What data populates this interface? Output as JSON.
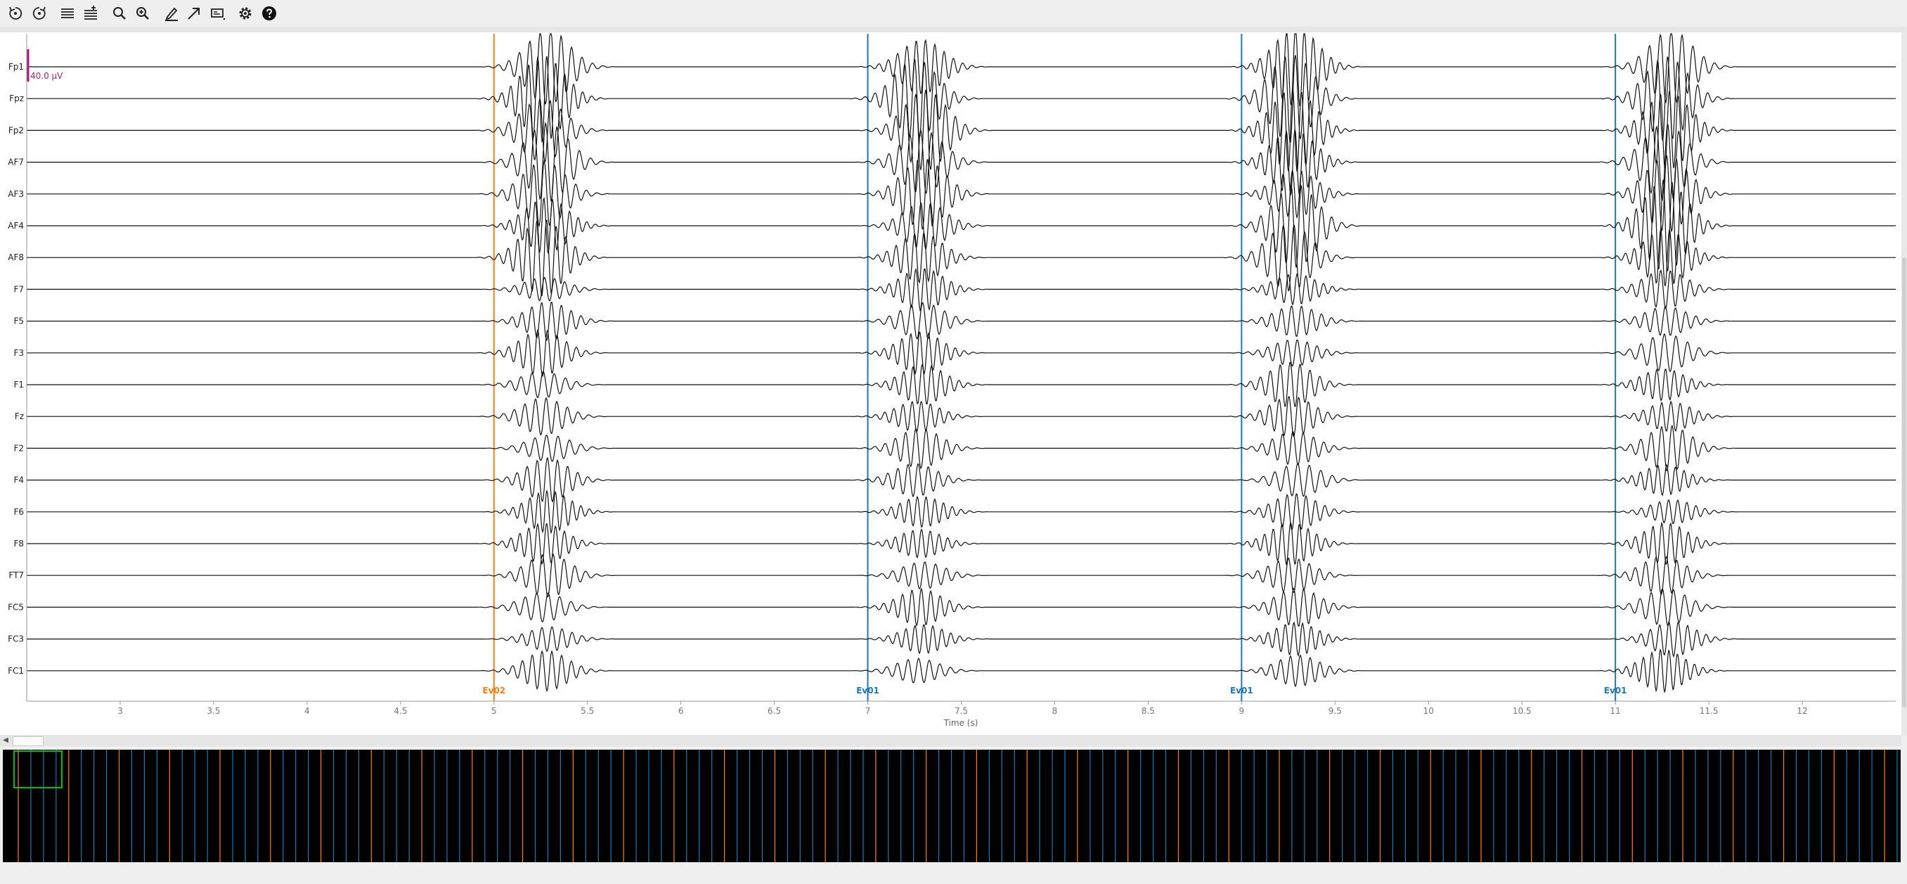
{
  "toolbar": {
    "buttons": [
      {
        "name": "undo-rotate-button",
        "icon": "rotate-left-icon"
      },
      {
        "name": "redo-rotate-button",
        "icon": "rotate-right-icon"
      },
      {
        "name": "fewer-channels-button",
        "icon": "lines-icon"
      },
      {
        "name": "more-channels-button",
        "icon": "lines-plus-icon"
      },
      {
        "name": "zoom-out-button",
        "icon": "zoom-out-icon"
      },
      {
        "name": "zoom-in-button",
        "icon": "zoom-in-icon"
      },
      {
        "name": "annotate-button",
        "icon": "pencil-icon"
      },
      {
        "name": "projectors-button",
        "icon": "arrow-icon"
      },
      {
        "name": "display-button",
        "icon": "display-icon"
      },
      {
        "name": "settings-button",
        "icon": "gear-icon"
      },
      {
        "name": "help-button",
        "icon": "help-icon"
      }
    ]
  },
  "channels": [
    "Fp1",
    "Fpz",
    "Fp2",
    "AF7",
    "AF3",
    "AF4",
    "AF8",
    "F7",
    "F5",
    "F3",
    "F1",
    "Fz",
    "F2",
    "F4",
    "F6",
    "F8",
    "FT7",
    "FC5",
    "FC3",
    "FC1"
  ],
  "scale_bar_label": "40.0 µV",
  "x_axis": {
    "label": "Time (s)",
    "range": [
      2.5,
      12.5
    ],
    "ticks": [
      "3",
      "3.5",
      "4",
      "4.5",
      "5",
      "5.5",
      "6",
      "6.5",
      "7",
      "7.5",
      "8",
      "8.5",
      "9",
      "9.5",
      "10",
      "10.5",
      "11",
      "11.5",
      "12"
    ],
    "tick_values": [
      3,
      3.5,
      4,
      4.5,
      5,
      5.5,
      6,
      6.5,
      7,
      7.5,
      8,
      8.5,
      9,
      9.5,
      10,
      10.5,
      11,
      11.5,
      12
    ]
  },
  "events": [
    {
      "time": 5.0,
      "label": "Ev02",
      "color": "#ff7f0e"
    },
    {
      "time": 7.0,
      "label": "Ev01",
      "color": "#1f77b4"
    },
    {
      "time": 9.0,
      "label": "Ev01",
      "color": "#1f77b4"
    },
    {
      "time": 11.0,
      "label": "Ev01",
      "color": "#1f77b4"
    }
  ],
  "colors": {
    "trace": "#000000",
    "scale": "#a3217a",
    "event_ev01": "#1f77b4",
    "event_ev02": "#ff7f0e",
    "overview_bg": "#000000",
    "overview_viewport": "#00c000"
  }
}
